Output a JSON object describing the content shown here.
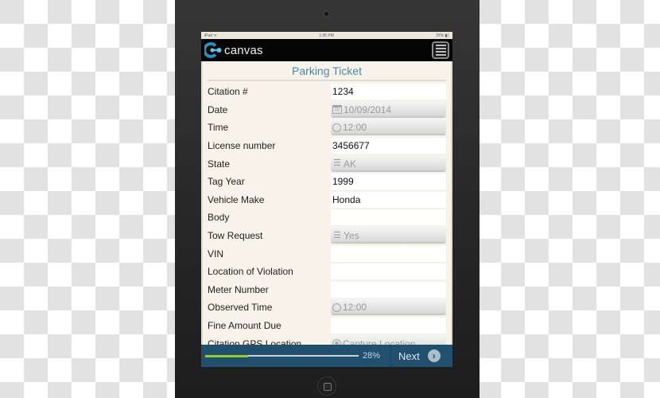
{
  "device": {
    "status_bar": {
      "carrier": "iPad ᯤ",
      "time": "1:35 PM",
      "battery": "25% ▮▯"
    }
  },
  "app": {
    "brand": "canvas",
    "menu_icon": "hamburger-menu-icon"
  },
  "form": {
    "title": "Parking Ticket",
    "rows": [
      {
        "label": "Citation #",
        "value": "1234",
        "type": "text"
      },
      {
        "label": "Date",
        "value": "10/09/2014",
        "type": "date",
        "icon": "calendar-icon"
      },
      {
        "label": "Time",
        "value": "12:00",
        "type": "time",
        "icon": "clock-icon"
      },
      {
        "label": "License number",
        "value": "3456677",
        "type": "text"
      },
      {
        "label": "State",
        "value": "AK",
        "type": "select",
        "icon": "list-icon"
      },
      {
        "label": "Tag Year",
        "value": "1999",
        "type": "text"
      },
      {
        "label": "Vehicle Make",
        "value": "Honda",
        "type": "text"
      },
      {
        "label": "Body",
        "value": "",
        "type": "text"
      },
      {
        "label": "Tow Request",
        "value": "Yes",
        "type": "select",
        "icon": "list-icon"
      },
      {
        "label": "VIN",
        "value": "",
        "type": "text"
      },
      {
        "label": "Location of Violation",
        "value": "",
        "type": "text"
      },
      {
        "label": "Meter Number",
        "value": "",
        "type": "text"
      },
      {
        "label": "Observed Time",
        "value": "12:00",
        "type": "time",
        "icon": "clock-icon"
      },
      {
        "label": "Fine Amount Due",
        "value": "",
        "type": "text"
      },
      {
        "label": "Citation GPS Location",
        "value": "Capture Location",
        "type": "gps",
        "icon": "location-icon"
      }
    ]
  },
  "footer": {
    "progress_percent": 28,
    "progress_label": "28%",
    "next_label": "Next",
    "next_icon": "chevron-right-circle-icon"
  },
  "colors": {
    "accent": "#4f86a6",
    "footer_bg": "#21506f",
    "progress_fill": "#9ccc2b"
  }
}
